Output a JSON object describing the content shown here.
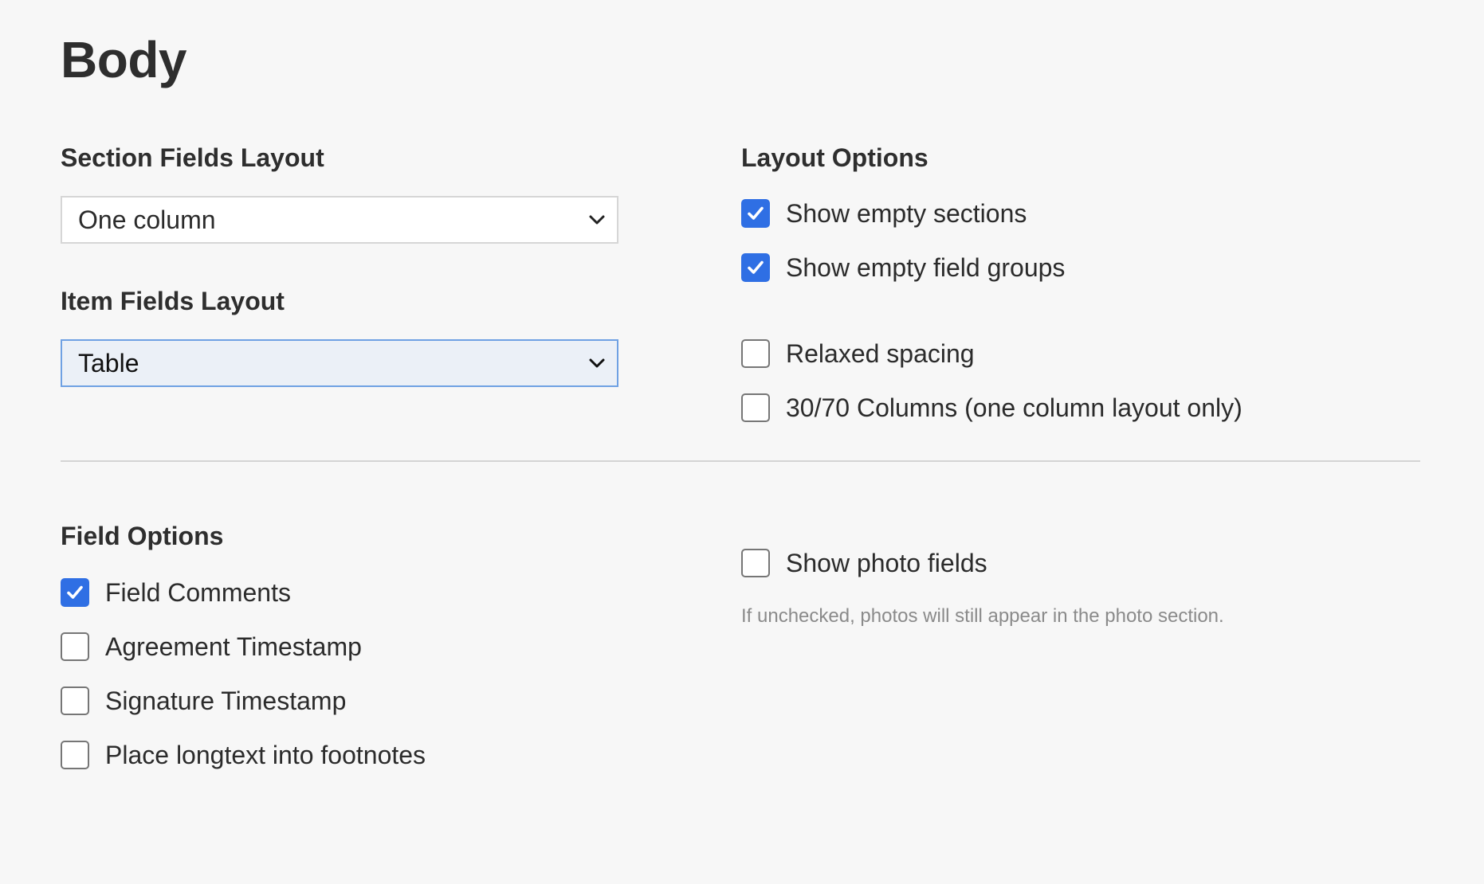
{
  "page": {
    "title": "Body"
  },
  "section_fields_layout": {
    "label": "Section Fields Layout",
    "selected": "One column"
  },
  "item_fields_layout": {
    "label": "Item Fields Layout",
    "selected": "Table"
  },
  "layout_options": {
    "label": "Layout Options",
    "items": [
      {
        "label": "Show empty sections",
        "checked": true
      },
      {
        "label": "Show empty field groups",
        "checked": true
      },
      {
        "label": "Relaxed spacing",
        "checked": false
      },
      {
        "label": "30/70 Columns (one column layout only)",
        "checked": false
      }
    ]
  },
  "field_options": {
    "label": "Field Options",
    "items": [
      {
        "label": "Field Comments",
        "checked": true
      },
      {
        "label": "Agreement Timestamp",
        "checked": false
      },
      {
        "label": "Signature Timestamp",
        "checked": false
      },
      {
        "label": "Place longtext into footnotes",
        "checked": false
      }
    ]
  },
  "photo_options": {
    "show_photo_fields": {
      "label": "Show photo fields",
      "checked": false
    },
    "hint": "If unchecked, photos will still appear in the photo section."
  },
  "colors": {
    "accent": "#2f6fe4",
    "background": "#f7f7f7",
    "focus_border": "#6fa1e3",
    "focus_fill": "#ebf0f7"
  },
  "icons": {
    "select_chevron": "chevron-down-icon",
    "check": "checkmark-icon"
  }
}
